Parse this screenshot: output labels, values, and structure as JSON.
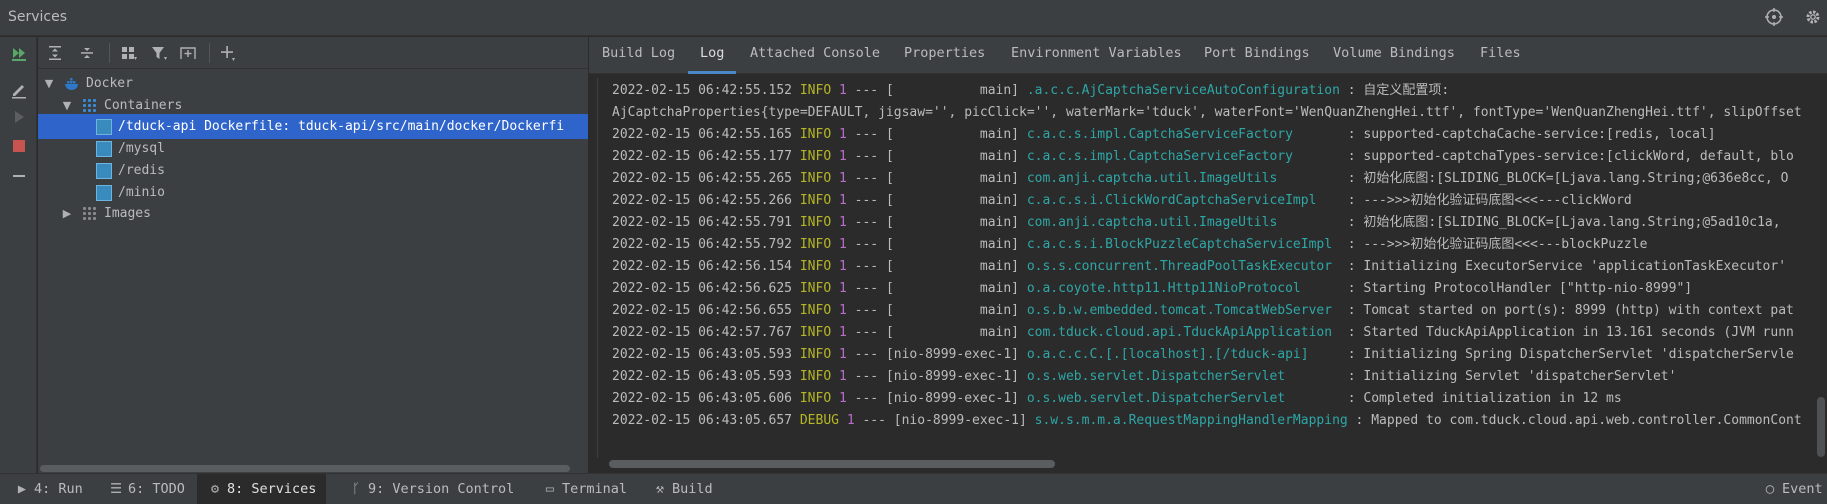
{
  "window": {
    "title": "Services"
  },
  "left_toolbar": {
    "icons": [
      "rerun-icon",
      "edit-icon",
      "run-icon",
      "stop-icon",
      "minus-icon"
    ]
  },
  "tree_toolbar": {
    "icons": [
      "expand-all-icon",
      "collapse-all-icon",
      "group-by-icon",
      "filter-icon",
      "new-tab-icon",
      "add-icon"
    ]
  },
  "tree": {
    "docker_label": "Docker",
    "containers_label": "Containers",
    "containers": [
      {
        "label": "/tduck-api Dockerfile: tduck-api/src/main/docker/Dockerfi",
        "selected": true
      },
      {
        "label": "/mysql",
        "selected": false
      },
      {
        "label": "/redis",
        "selected": false
      },
      {
        "label": "/minio",
        "selected": false
      }
    ],
    "images_label": "Images"
  },
  "tabs": [
    {
      "label": "Build Log",
      "active": false
    },
    {
      "label": "Log",
      "active": true
    },
    {
      "label": "Attached Console",
      "active": false
    },
    {
      "label": "Properties",
      "active": false
    },
    {
      "label": "Environment Variables",
      "active": false
    },
    {
      "label": "Port Bindings",
      "active": false
    },
    {
      "label": "Volume Bindings",
      "active": false
    },
    {
      "label": "Files",
      "active": false
    }
  ],
  "log_lines": [
    {
      "ts": "2022-02-15 06:42:55.152",
      "level": "INFO",
      "pid": "1",
      "thread": " --- [           main] ",
      "logger": ".a.c.c.AjCaptchaServiceAutoConfiguration",
      "msg": " : 自定义配置项:"
    },
    {
      "ts": "",
      "level": "",
      "pid": "",
      "thread": "",
      "logger": "",
      "msg": "AjCaptchaProperties{type=DEFAULT, jigsaw='', picClick='', waterMark='tduck', waterFont='WenQuanZhengHei.ttf', fontType='WenQuanZhengHei.ttf', slipOffset"
    },
    {
      "ts": "2022-02-15 06:42:55.165",
      "level": "INFO",
      "pid": "1",
      "thread": " --- [           main] ",
      "logger": "c.a.c.s.impl.CaptchaServiceFactory      ",
      "msg": " : supported-captchaCache-service:[redis, local]"
    },
    {
      "ts": "2022-02-15 06:42:55.177",
      "level": "INFO",
      "pid": "1",
      "thread": " --- [           main] ",
      "logger": "c.a.c.s.impl.CaptchaServiceFactory      ",
      "msg": " : supported-captchaTypes-service:[clickWord, default, blo"
    },
    {
      "ts": "2022-02-15 06:42:55.265",
      "level": "INFO",
      "pid": "1",
      "thread": " --- [           main] ",
      "logger": "com.anji.captcha.util.ImageUtils        ",
      "msg": " : 初始化底图:[SLIDING_BLOCK=[Ljava.lang.String;@636e8cc, O"
    },
    {
      "ts": "2022-02-15 06:42:55.266",
      "level": "INFO",
      "pid": "1",
      "thread": " --- [           main] ",
      "logger": "c.a.c.s.i.ClickWordCaptchaServiceImpl   ",
      "msg": " : --->>>初始化验证码底图<<<---clickWord"
    },
    {
      "ts": "2022-02-15 06:42:55.791",
      "level": "INFO",
      "pid": "1",
      "thread": " --- [           main] ",
      "logger": "com.anji.captcha.util.ImageUtils        ",
      "msg": " : 初始化底图:[SLIDING_BLOCK=[Ljava.lang.String;@5ad10c1a,"
    },
    {
      "ts": "2022-02-15 06:42:55.792",
      "level": "INFO",
      "pid": "1",
      "thread": " --- [           main] ",
      "logger": "c.a.c.s.i.BlockPuzzleCaptchaServiceImpl ",
      "msg": " : --->>>初始化验证码底图<<<---blockPuzzle"
    },
    {
      "ts": "2022-02-15 06:42:56.154",
      "level": "INFO",
      "pid": "1",
      "thread": " --- [           main] ",
      "logger": "o.s.s.concurrent.ThreadPoolTaskExecutor ",
      "msg": " : Initializing ExecutorService 'applicationTaskExecutor'"
    },
    {
      "ts": "2022-02-15 06:42:56.625",
      "level": "INFO",
      "pid": "1",
      "thread": " --- [           main] ",
      "logger": "o.a.coyote.http11.Http11NioProtocol     ",
      "msg": " : Starting ProtocolHandler [\"http-nio-8999\"]"
    },
    {
      "ts": "2022-02-15 06:42:56.655",
      "level": "INFO",
      "pid": "1",
      "thread": " --- [           main] ",
      "logger": "o.s.b.w.embedded.tomcat.TomcatWebServer ",
      "msg": " : Tomcat started on port(s): 8999 (http) with context pat"
    },
    {
      "ts": "2022-02-15 06:42:57.767",
      "level": "INFO",
      "pid": "1",
      "thread": " --- [           main] ",
      "logger": "com.tduck.cloud.api.TduckApiApplication ",
      "msg": " : Started TduckApiApplication in 13.161 seconds (JVM runn"
    },
    {
      "ts": "2022-02-15 06:43:05.593",
      "level": "INFO",
      "pid": "1",
      "thread": " --- [nio-8999-exec-1] ",
      "logger": "o.a.c.c.C.[.[localhost].[/tduck-api]    ",
      "msg": " : Initializing Spring DispatcherServlet 'dispatcherServle"
    },
    {
      "ts": "2022-02-15 06:43:05.593",
      "level": "INFO",
      "pid": "1",
      "thread": " --- [nio-8999-exec-1] ",
      "logger": "o.s.web.servlet.DispatcherServlet       ",
      "msg": " : Initializing Servlet 'dispatcherServlet'"
    },
    {
      "ts": "2022-02-15 06:43:05.606",
      "level": "INFO",
      "pid": "1",
      "thread": " --- [nio-8999-exec-1] ",
      "logger": "o.s.web.servlet.DispatcherServlet       ",
      "msg": " : Completed initialization in 12 ms"
    },
    {
      "ts": "2022-02-15 06:43:05.657",
      "level": "DEBUG",
      "pid": "1",
      "thread": " --- [nio-8999-exec-1] ",
      "logger": "s.w.s.m.m.a.RequestMappingHandlerMapping",
      "msg": " : Mapped to com.tduck.cloud.api.web.controller.CommonCont"
    }
  ],
  "status_bar": [
    {
      "label": "4: Run",
      "icon": "run-icon",
      "active": false
    },
    {
      "label": "6: TODO",
      "icon": "list-icon",
      "active": false
    },
    {
      "label": "8: Services",
      "icon": "services-icon",
      "active": true
    },
    {
      "label": "9: Version Control",
      "icon": "vcs-icon",
      "active": false
    },
    {
      "label": "Terminal",
      "icon": "terminal-icon",
      "active": false
    },
    {
      "label": "Build",
      "icon": "hammer-icon",
      "active": false
    },
    {
      "label": "Event",
      "icon": "event-log-icon",
      "active": false
    }
  ]
}
